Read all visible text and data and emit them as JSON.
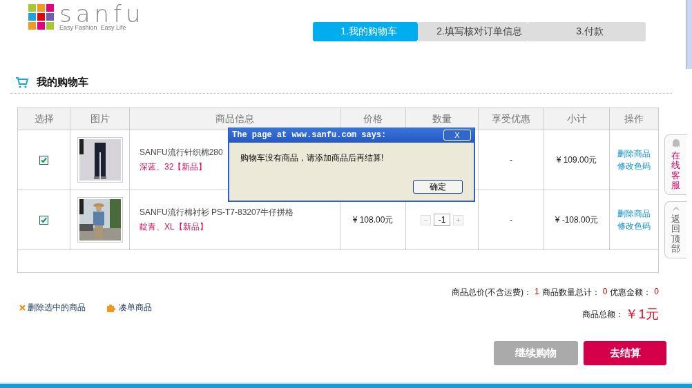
{
  "logo": {
    "name": "sanfu",
    "tagline": "Easy Fashion  Easy Life"
  },
  "steps": [
    {
      "label": "1.我的购物车",
      "selected": true
    },
    {
      "label": "2.填写核对订单信息",
      "selected": false
    },
    {
      "label": "3.付款",
      "selected": false
    }
  ],
  "section_title": "我的购物车",
  "table": {
    "columns": [
      "选择",
      "图片",
      "商品信息",
      "价格",
      "数量",
      "享受优惠",
      "小计",
      "操作"
    ],
    "rows": [
      {
        "checked": true,
        "picture": {
          "kind": "picture"
        },
        "name": "SANFU流行针织棉280",
        "variant": "深蓝、32【新品】",
        "discount": "-",
        "subtotal": "¥ 109.00元",
        "actions": [
          "删除商品",
          "修改色码"
        ]
      },
      {
        "checked": true,
        "picture": {
          "kind": "picture"
        },
        "name": "SANFU流行棉衬衫 PS-T7-83207牛仔拼格",
        "variant": "靛青、XL【新品】",
        "price": "¥ 108.00元",
        "quantity": {
          "minus": "−",
          "value": "-1",
          "plus": "+"
        },
        "discount": "-",
        "subtotal": "¥ -108.00元",
        "actions": [
          "删除商品",
          "修改色码"
        ]
      }
    ]
  },
  "footer_links": [
    "删除选中的商品",
    "凑单商品"
  ],
  "summary": {
    "price_label": "商品总价(不含运费)：",
    "price": "1",
    "count_label": "商品数量总计：",
    "count": "0",
    "discount_label": "优惠金额：",
    "discount": "0",
    "total_label": "商品总额：",
    "total": "￥1元"
  },
  "buttons": [
    "继续购物",
    "去结算"
  ],
  "side_tabs": [
    "在线客服",
    "返回顶部"
  ],
  "dialog": {
    "title": "The page at www.sanfu.com says:",
    "close": "X",
    "message": "购物车没有商品，请添加商品后再结算!",
    "ok": "确定"
  }
}
